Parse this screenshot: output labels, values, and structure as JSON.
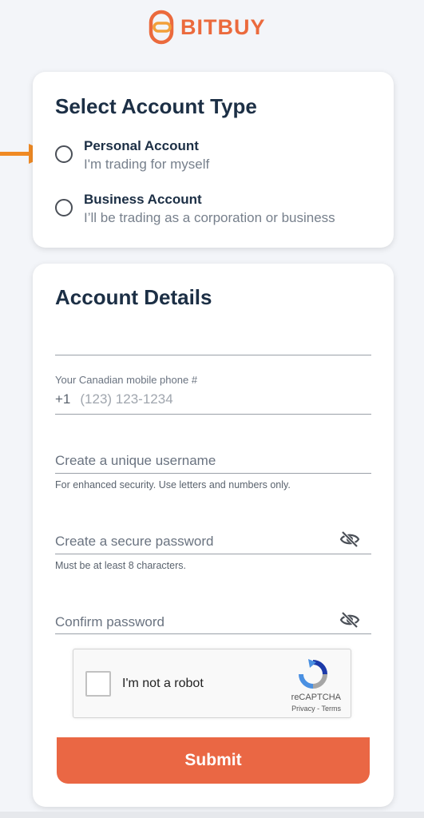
{
  "brand": {
    "name": "BITBUY",
    "color": "#eb6a3d"
  },
  "account_type": {
    "title": "Select Account Type",
    "options": [
      {
        "title": "Personal Account",
        "subtitle": "I'm trading for myself",
        "selected": false
      },
      {
        "title": "Business Account",
        "subtitle": "I’ll be trading as a corporation or business",
        "selected": false
      }
    ]
  },
  "account_details": {
    "title": "Account Details",
    "blank_field": {
      "value": ""
    },
    "phone": {
      "label": "Your Canadian mobile phone #",
      "prefix": "+1",
      "placeholder": "(123) 123-1234",
      "value": ""
    },
    "username": {
      "placeholder": "Create a unique username",
      "helper": "For enhanced security. Use letters and numbers only.",
      "value": ""
    },
    "password": {
      "placeholder": "Create a secure password",
      "helper": "Must be at least 8 characters.",
      "icon": "eye-slash-icon",
      "value": ""
    },
    "confirm_password": {
      "placeholder": "Confirm password",
      "icon": "eye-slash-icon",
      "value": ""
    }
  },
  "recaptcha": {
    "label": "I'm not a robot",
    "brand": "reCAPTCHA",
    "privacy": "Privacy",
    "separator": " - ",
    "terms": "Terms",
    "checked": false
  },
  "submit": {
    "label": "Submit",
    "color": "#ea6744"
  },
  "annotation": {
    "icon": "arrow-right-icon",
    "color": "#f08a24"
  }
}
